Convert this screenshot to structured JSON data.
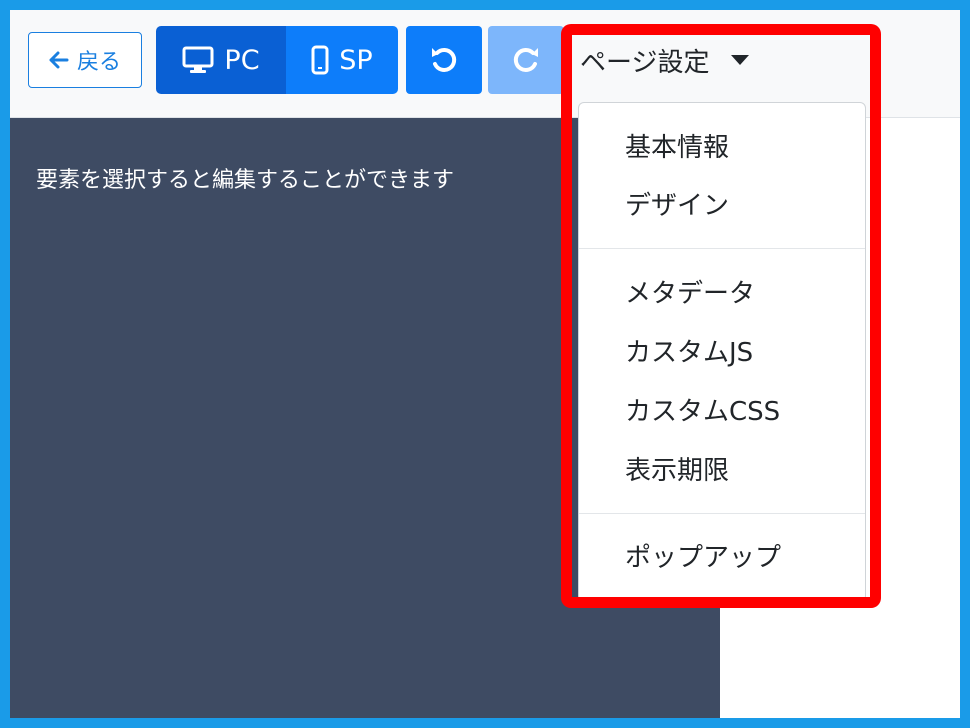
{
  "toolbar": {
    "back_label": "戻る",
    "pc_label": "PC",
    "sp_label": "SP",
    "page_settings_label": "ページ設定"
  },
  "editor": {
    "hint": "要素を選択すると編集することができます"
  },
  "dropdown": {
    "groups": [
      [
        "基本情報",
        "デザイン"
      ],
      [
        "メタデータ",
        "カスタムJS",
        "カスタムCSS",
        "表示期限"
      ],
      [
        "ポップアップ"
      ]
    ]
  },
  "colors": {
    "primary": "#0d7dfa",
    "primary_active": "#0a60d4",
    "primary_disabled": "#7db6fb",
    "editor_bg": "#3e4b63",
    "highlight": "#ff0000",
    "outer_border": "#1a9be8"
  }
}
